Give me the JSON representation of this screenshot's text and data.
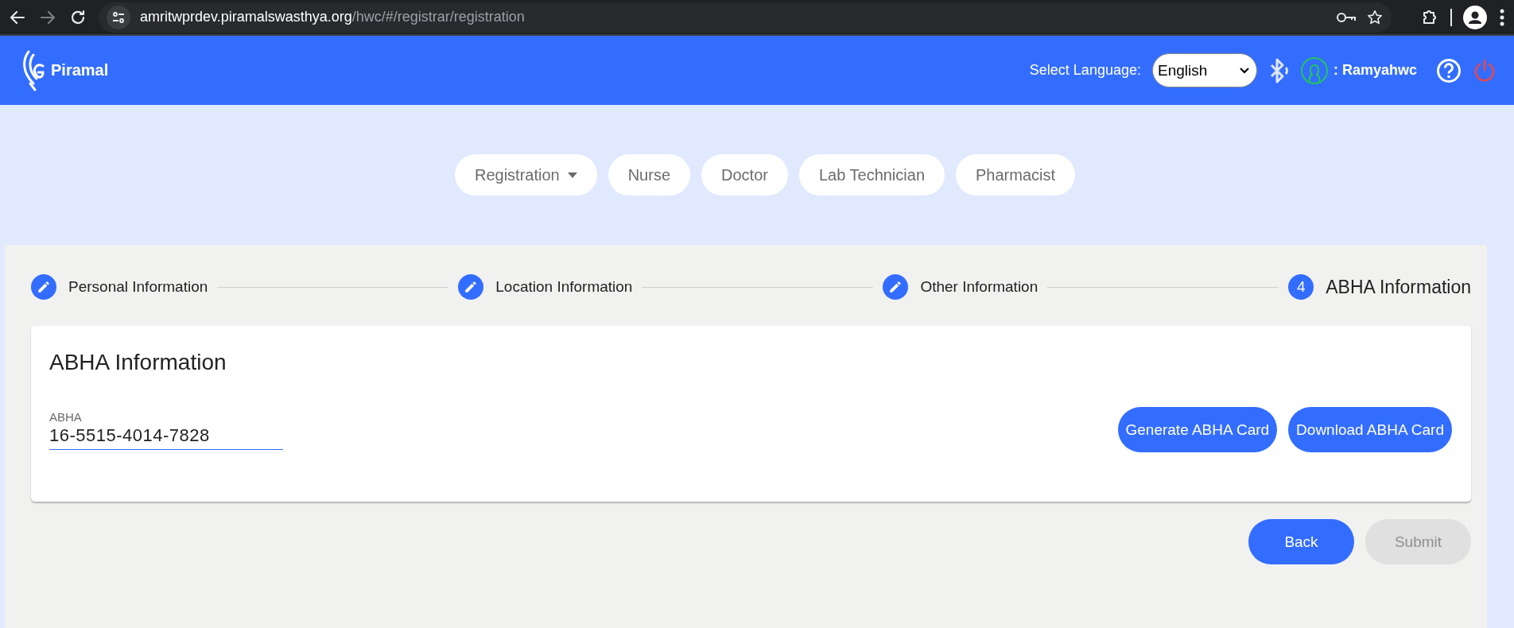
{
  "browser": {
    "url_host": "amritwprdev.piramalswasthya.org",
    "url_path": "/hwc/#/registrar/registration"
  },
  "header": {
    "brand": "Piramal",
    "language_label": "Select Language:",
    "language": "English",
    "user": ": Ramyahwc"
  },
  "nav": [
    {
      "label": "Registration",
      "has_menu": true
    },
    {
      "label": "Nurse",
      "has_menu": false
    },
    {
      "label": "Doctor",
      "has_menu": false
    },
    {
      "label": "Lab Technician",
      "has_menu": false
    },
    {
      "label": "Pharmacist",
      "has_menu": false
    }
  ],
  "stepper": [
    {
      "label": "Personal Information",
      "completed": true
    },
    {
      "label": "Location Information",
      "completed": true
    },
    {
      "label": "Other Information",
      "completed": true
    },
    {
      "label": "ABHA Information",
      "completed": false,
      "number": "4"
    }
  ],
  "card": {
    "title": "ABHA Information",
    "field": {
      "label": "ABHA",
      "value": "16-5515-4014-7828"
    },
    "buttons": [
      "Generate ABHA Card",
      "Download ABHA Card"
    ]
  },
  "actions": [
    {
      "label": "Back",
      "disabled": false
    },
    {
      "label": "Submit",
      "disabled": true
    }
  ]
}
